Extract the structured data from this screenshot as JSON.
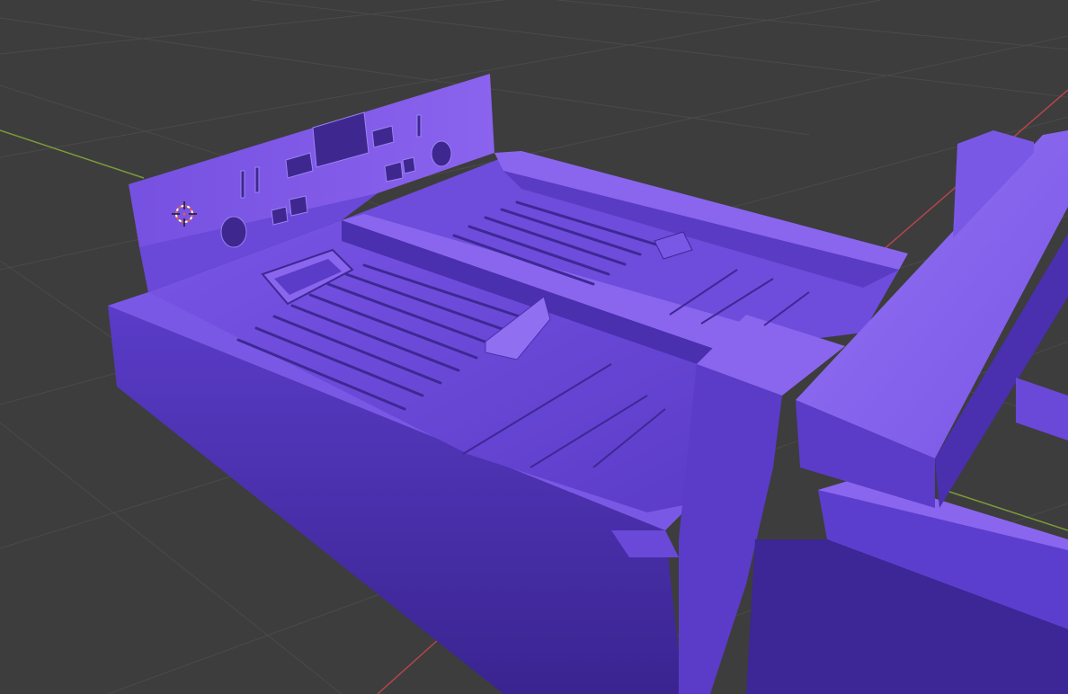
{
  "app": {
    "view": "3d-viewport",
    "shading": "solid",
    "object": "car-floor-pan-mesh"
  },
  "colors": {
    "background": "#3d3d3d",
    "grid_line": "#4a4a4a",
    "x_axis": "#b4454c",
    "y_axis": "#7a9a3a",
    "mesh_light": "#8a63ee",
    "mesh_mid": "#6a46d6",
    "mesh_dark": "#3d2696",
    "mesh_shadow": "#2c1b72",
    "cursor_ring": "#e06040"
  },
  "icons": {
    "cursor": "3d-cursor-icon"
  }
}
